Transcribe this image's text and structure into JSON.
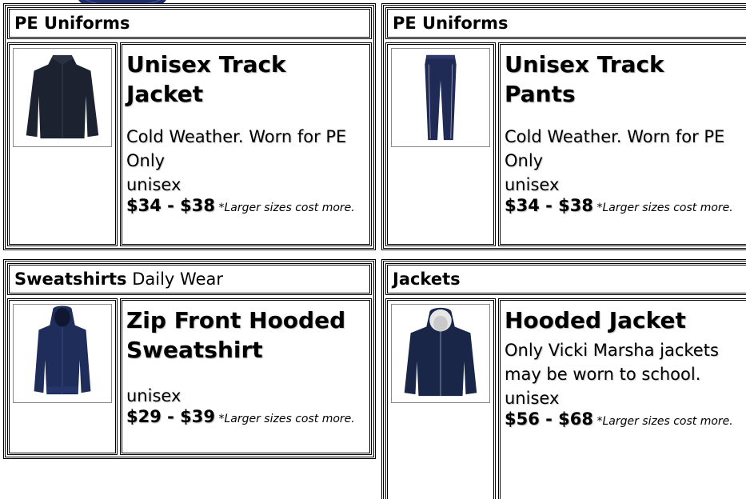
{
  "products": [
    {
      "category": "PE Uniforms",
      "category_sub": "",
      "title": "Unisex Track Jacket",
      "description": "Cold Weather. Worn for PE Only",
      "gender": "unisex",
      "price": "$34 - $38",
      "note": "*Larger sizes cost more.",
      "image_icon": "track-jacket-icon",
      "image_color": "#1c2230"
    },
    {
      "category": "PE Uniforms",
      "category_sub": "",
      "title": "Unisex Track Pants",
      "description": "Cold Weather. Worn for PE Only",
      "gender": "unisex",
      "price": "$34 - $38",
      "note": "*Larger sizes cost more.",
      "image_icon": "track-pants-icon",
      "image_color": "#1f2a55"
    },
    {
      "category": "Sweatshirts",
      "category_sub": "Daily Wear",
      "title": "Zip Front Hooded Sweatshirt",
      "description": "",
      "gender": "unisex",
      "price": "$29 - $39",
      "note": "*Larger sizes cost more.",
      "image_icon": "hooded-sweatshirt-icon",
      "image_color": "#1e2d5a"
    },
    {
      "category": "Jackets",
      "category_sub": "",
      "title": "Hooded Jacket",
      "description": "Only Vicki Marsha jackets may be worn to school.",
      "gender": "unisex",
      "price": "$56 - $68",
      "note": "*Larger sizes cost more.",
      "image_icon": "hooded-jacket-icon",
      "image_color": "#1a2648"
    }
  ]
}
